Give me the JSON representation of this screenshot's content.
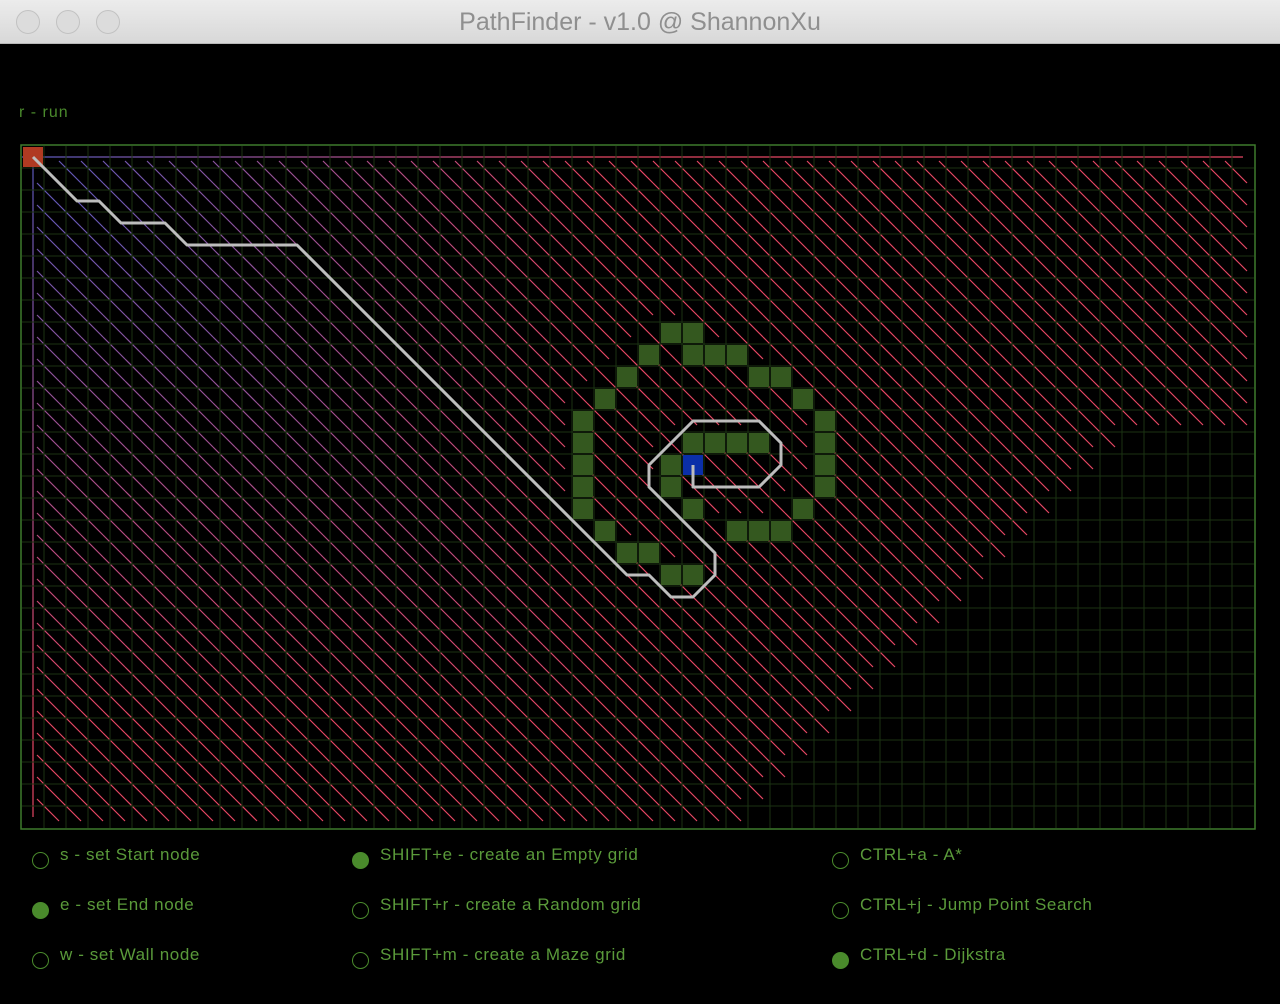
{
  "window": {
    "title": "PathFinder - v1.0 @ ShannonXu"
  },
  "hint": "r - run",
  "colors": {
    "background": "#000000",
    "grid_line": "#1b3212",
    "grid_border": "#3e7a2c",
    "wall": "#34581f",
    "start": "#b03a22",
    "end": "#0b2fa8",
    "path": "#bdbdbd",
    "accent_text": "#5a9a3a"
  },
  "grid": {
    "cols": 56,
    "rows": 31,
    "start": [
      0,
      0
    ],
    "end": [
      30,
      14
    ],
    "walls": [
      [
        29,
        8
      ],
      [
        30,
        8
      ],
      [
        31,
        9
      ],
      [
        30,
        9
      ],
      [
        32,
        9
      ],
      [
        28,
        9
      ],
      [
        27,
        10
      ],
      [
        33,
        10
      ],
      [
        34,
        10
      ],
      [
        26,
        11
      ],
      [
        35,
        11
      ],
      [
        36,
        12
      ],
      [
        25,
        12
      ],
      [
        25,
        13
      ],
      [
        25,
        14
      ],
      [
        25,
        15
      ],
      [
        25,
        16
      ],
      [
        36,
        13
      ],
      [
        36,
        14
      ],
      [
        36,
        15
      ],
      [
        35,
        16
      ],
      [
        26,
        17
      ],
      [
        27,
        18
      ],
      [
        28,
        18
      ],
      [
        29,
        19
      ],
      [
        30,
        19
      ],
      [
        34,
        17
      ],
      [
        33,
        17
      ],
      [
        32,
        17
      ],
      [
        31,
        13
      ],
      [
        32,
        13
      ],
      [
        33,
        13
      ],
      [
        30,
        13
      ],
      [
        29,
        14
      ],
      [
        29,
        15
      ],
      [
        30,
        16
      ]
    ],
    "path": [
      [
        0,
        0
      ],
      [
        2,
        2
      ],
      [
        3,
        2
      ],
      [
        4,
        3
      ],
      [
        6,
        3
      ],
      [
        7,
        4
      ],
      [
        12,
        4
      ],
      [
        26,
        18
      ],
      [
        27,
        19
      ],
      [
        28,
        19
      ],
      [
        29,
        20
      ],
      [
        30,
        20
      ],
      [
        31,
        19
      ],
      [
        31,
        18
      ],
      [
        28,
        15
      ],
      [
        28,
        14
      ],
      [
        29,
        13
      ],
      [
        30,
        12
      ],
      [
        33,
        12
      ],
      [
        34,
        13
      ],
      [
        34,
        14
      ],
      [
        33,
        15
      ],
      [
        30,
        15
      ],
      [
        30,
        14
      ]
    ]
  },
  "options": {
    "modes": [
      {
        "label": "s - set Start node",
        "selected": false
      },
      {
        "label": "e - set End node",
        "selected": true
      },
      {
        "label": "w - set Wall node",
        "selected": false
      }
    ],
    "grids": [
      {
        "label": "SHIFT+e - create an Empty grid",
        "selected": true
      },
      {
        "label": "SHIFT+r  - create a Random grid",
        "selected": false
      },
      {
        "label": "SHIFT+m - create a Maze grid",
        "selected": false
      }
    ],
    "algorithms": [
      {
        "label": "CTRL+a - A*",
        "selected": false
      },
      {
        "label": "CTRL+j - Jump Point Search",
        "selected": false
      },
      {
        "label": "CTRL+d - Dijkstra",
        "selected": true
      }
    ]
  }
}
